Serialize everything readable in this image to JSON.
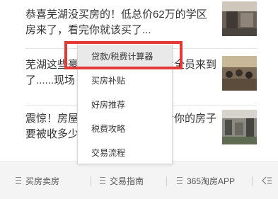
{
  "feed": {
    "articles": [
      {
        "title": "恭喜芜湖没买房的！低总价62万的学区房来了，看完你就该买了..."
      },
      {
        "title": "芜湖这些豪宅就要交付了！物业全员来到了......现场"
      },
      {
        "title": "震惊！房屋没证也能买卖？看看你的房子要被收多少！"
      }
    ]
  },
  "bottom_nav": {
    "items": [
      {
        "label": "买房卖房"
      },
      {
        "label": "交易指南"
      },
      {
        "label": "365淘房APP"
      }
    ]
  },
  "menu": {
    "items": [
      {
        "label": "贷款/税费计算器"
      },
      {
        "label": "买房补贴"
      },
      {
        "label": "好房推荐"
      },
      {
        "label": "税费攻略"
      },
      {
        "label": "交易流程"
      }
    ]
  }
}
